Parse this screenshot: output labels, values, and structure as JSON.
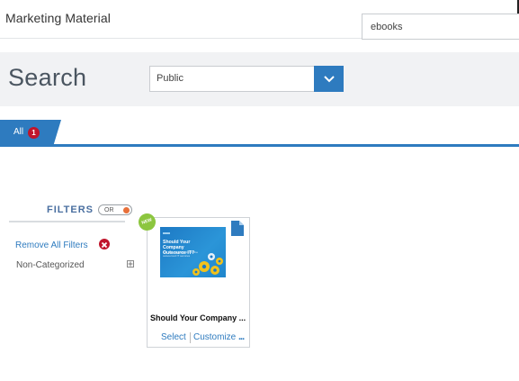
{
  "header": {
    "title": "Marketing Material"
  },
  "search": {
    "label": "Search",
    "scope_value": "Public",
    "query_value": "ebooks"
  },
  "tabs": [
    {
      "label": "All",
      "count": "1"
    }
  ],
  "filters": {
    "heading": "FILTERS",
    "mode_toggle": "OR",
    "remove_all_label": "Remove All Filters",
    "categories": [
      "Non-Categorized"
    ]
  },
  "results": [
    {
      "badge": "NEW",
      "title": "Should Your Company ...",
      "thumbnail_title": "Should Your Company Outsource IT?",
      "thumbnail_subtitle": "Key factors to help determine outsourced IT services",
      "actions": {
        "select": "Select",
        "customize": "Customize",
        "more": "..."
      }
    }
  ],
  "colors": {
    "accent": "#2e7bbf",
    "badge_red": "#c0152b",
    "new_green": "#8cc63f",
    "toggle_orange": "#e8703a"
  }
}
